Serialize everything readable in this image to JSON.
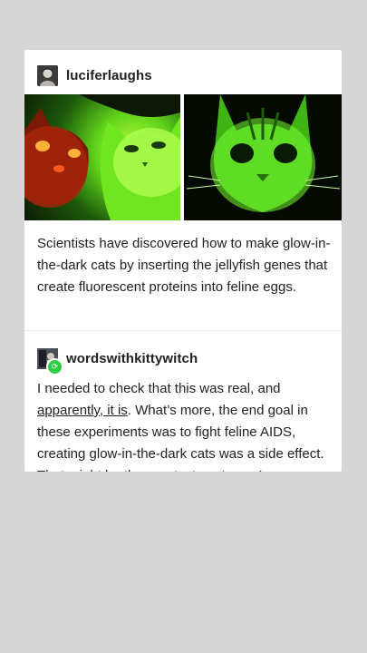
{
  "post": {
    "username": "luciferlaughs",
    "avatar_icon": "user-avatar-icon",
    "caption": "Scientists have discovered how to make glow-in-the-dark cats by  inserting the jellyfish genes that create fluorescent proteins into feline eggs."
  },
  "reblog": {
    "username": "wordswithkittywitch",
    "avatar_icon": "user-avatar-icon",
    "badge_icon": "reblog-icon",
    "text_before": "I needed to check that this was real, and ",
    "link_text": "apparently, it is",
    "text_after": ". What’s more, the end goal in these experiments was to fight feline AIDS, creating glow-in-the-dark cats was a side effect. That might be the greatest sentence I"
  },
  "colors": {
    "background": "#d6d6d6",
    "card": "#ffffff",
    "text": "#222222",
    "glow_green": "#77ff2a",
    "glow_red": "#ff3a1a",
    "badge_green": "#2ecc40"
  }
}
